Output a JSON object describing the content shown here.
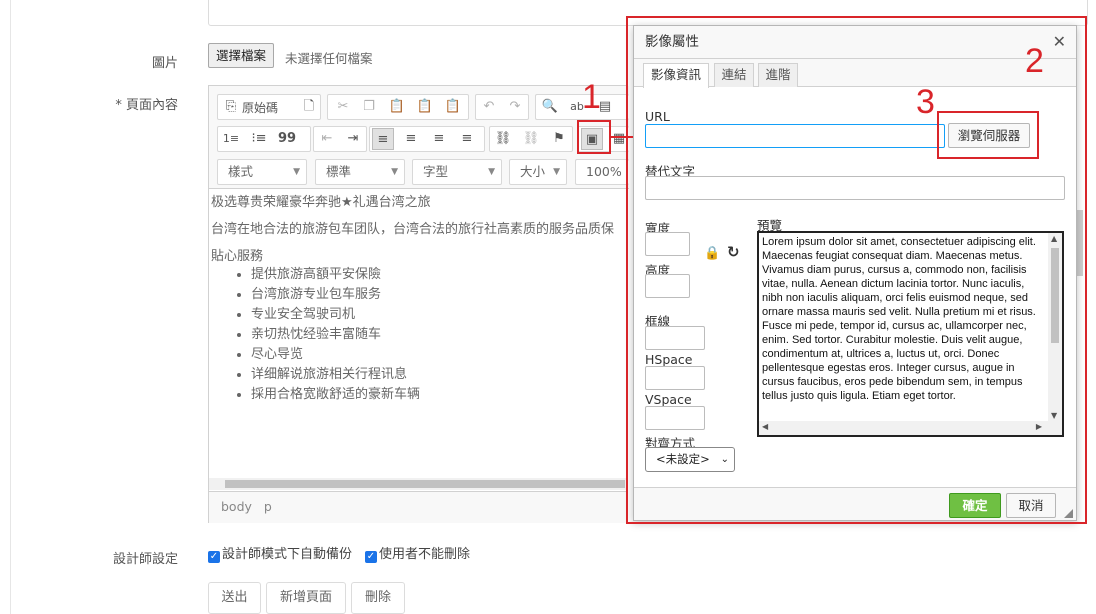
{
  "form": {
    "image_label": "圖片",
    "file_button": "選擇檔案",
    "file_status": "未選擇任何檔案",
    "content_label": "* 頁面內容",
    "designer_label": "設計師設定"
  },
  "editor": {
    "source_label": "原始碼",
    "combos": [
      "樣式",
      "標準",
      "字型",
      "大小"
    ],
    "zoom": "100%",
    "content": {
      "line1": "极选尊贵荣耀豪华奔驰★礼遇台湾之旅",
      "line2": "台湾在地合法的旅游包车团队，台湾合法的旅行社高素质的服务品质保",
      "heading": "貼心服務",
      "items": [
        "提供旅游高額平安保險",
        "台湾旅游专业包车服务",
        "专业安全驾驶司机",
        "亲切热忱经验丰富随车",
        "尽心导览",
        "详细解说旅游相关行程讯息",
        "採用合格宽敞舒适的豪新车辆"
      ]
    },
    "path": [
      "body",
      "p"
    ]
  },
  "checkboxes": [
    {
      "label": "設計師模式下自動備份",
      "checked": true
    },
    {
      "label": "使用者不能刪除",
      "checked": true
    }
  ],
  "buttons": {
    "submit": "送出",
    "new_page": "新增頁面",
    "delete": "刪除"
  },
  "dialog": {
    "title": "影像屬性",
    "tabs": [
      "影像資訊",
      "連結",
      "進階"
    ],
    "url_label": "URL",
    "url_value": "",
    "browse_button": "瀏覽伺服器",
    "alt_label": "替代文字",
    "width_label": "寬度",
    "height_label": "高度",
    "border_label": "框線",
    "hspace_label": "HSpace",
    "vspace_label": "VSpace",
    "align_label": "對齊方式",
    "align_value": "<未設定>",
    "preview_label": "預覽",
    "preview_text": "Lorem ipsum dolor sit amet, consectetuer adipiscing elit. Maecenas feugiat consequat diam. Maecenas metus. Vivamus diam purus, cursus a, commodo non, facilisis vitae, nulla. Aenean dictum lacinia tortor. Nunc iaculis, nibh non iaculis aliquam, orci felis euismod neque, sed ornare massa mauris sed velit. Nulla pretium mi et risus. Fusce mi pede, tempor id, cursus ac, ullamcorper nec, enim. Sed tortor. Curabitur molestie. Duis velit augue, condimentum at, ultrices a, luctus ut, orci. Donec pellentesque egestas eros. Integer cursus, augue in cursus faucibus, eros pede bibendum sem, in tempus tellus justo quis ligula. Etiam eget tortor.",
    "ok_button": "確定",
    "cancel_button": "取消"
  },
  "annotations": [
    "1",
    "2",
    "3"
  ],
  "colors": {
    "annotation": "#d9252a",
    "ok_green": "#6fc043",
    "focus_blue": "#139ff7"
  }
}
